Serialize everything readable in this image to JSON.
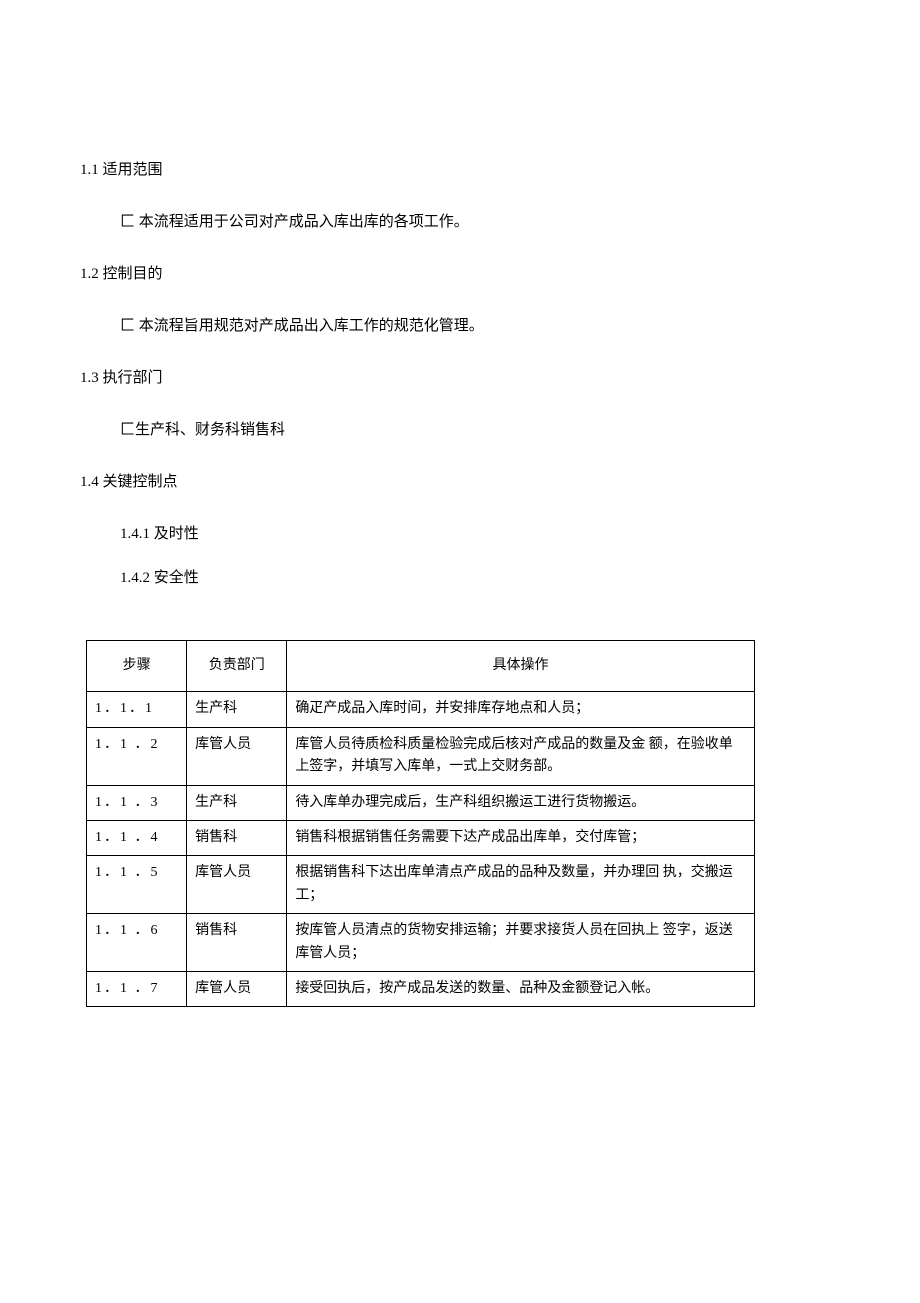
{
  "sections": {
    "s1_1": {
      "heading": "1.1 适用范围",
      "body": "匚 本流程适用于公司对产成品入库出库的各项工作。"
    },
    "s1_2": {
      "heading": "1.2 控制目的",
      "body": "匚 本流程旨用规范对产成品出入库工作的规范化管理。"
    },
    "s1_3": {
      "heading": "1.3 执行部门",
      "body": "匚生产科、财务科销售科"
    },
    "s1_4": {
      "heading": "1.4 关键控制点",
      "items": {
        "i1": "1.4.1 及时性",
        "i2": "1.4.2 安全性"
      }
    }
  },
  "table": {
    "headers": {
      "h1": "步骤",
      "h2": "负责部门",
      "h3": "具体操作"
    },
    "rows": {
      "r1": {
        "step": "1．1．1",
        "dept": "生产科",
        "op": "确疋产成品入库时间，并安排库存地点和人员；"
      },
      "r2": {
        "step": "1．1 ．2",
        "dept": "库管人员",
        "op": "库管人员待质检科质量检验完成后核对产成品的数量及金 额，在验收单上签字，并填写入库单，一式上交财务部。"
      },
      "r3": {
        "step": "1．1 ．3",
        "dept": "生产科",
        "op": "待入库单办理完成后，生产科组织搬运工进行货物搬运。"
      },
      "r4": {
        "step": "1．1 ．4",
        "dept": "销售科",
        "op": "销售科根据销售任务需要下达产成品出库单，交付库管；"
      },
      "r5": {
        "step": "1．1 ．5",
        "dept": "库管人员",
        "op": "根据销售科下达出库单清点产成品的品种及数量，并办理回 执，交搬运工；"
      },
      "r6": {
        "step": "1．1 ．6",
        "dept": "销售科",
        "op": "按库管人员清点的货物安排运输；并要求接货人员在回执上 签字，返送库管人员；"
      },
      "r7": {
        "step": "1．1 ．7",
        "dept": "库管人员",
        "op": "接受回执后，按产成品发送的数量、品种及金额登记入帐。"
      }
    }
  }
}
